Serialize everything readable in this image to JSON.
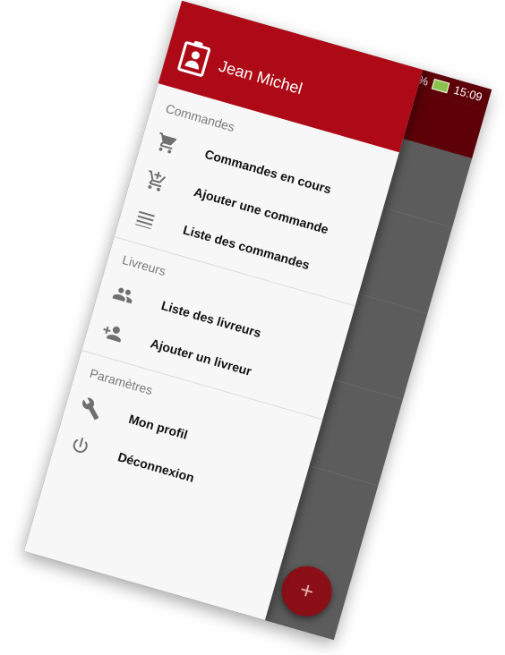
{
  "status_bar": {
    "battery": "49%",
    "network": "4G",
    "time": "15:09"
  },
  "drawer": {
    "user_name": "Jean Michel",
    "sections": [
      {
        "title": "Commandes",
        "items": [
          {
            "label": "Commandes en cours",
            "icon": "cart-icon"
          },
          {
            "label": "Ajouter une commande",
            "icon": "cart-add-icon"
          },
          {
            "label": "Liste des commandes",
            "icon": "list-icon"
          }
        ]
      },
      {
        "title": "Livreurs",
        "items": [
          {
            "label": "Liste des livreurs",
            "icon": "people-icon"
          },
          {
            "label": "Ajouter un livreur",
            "icon": "person-add-icon"
          }
        ]
      },
      {
        "title": "Paramètres",
        "items": [
          {
            "label": "Mon profil",
            "icon": "wrench-icon"
          },
          {
            "label": "Déconnexion",
            "icon": "power-icon"
          }
        ]
      }
    ]
  },
  "fab": {
    "label": "+"
  },
  "colors": {
    "primary": "#ad0916",
    "primary_dark": "#5d0008",
    "fab": "#8a0f17"
  }
}
